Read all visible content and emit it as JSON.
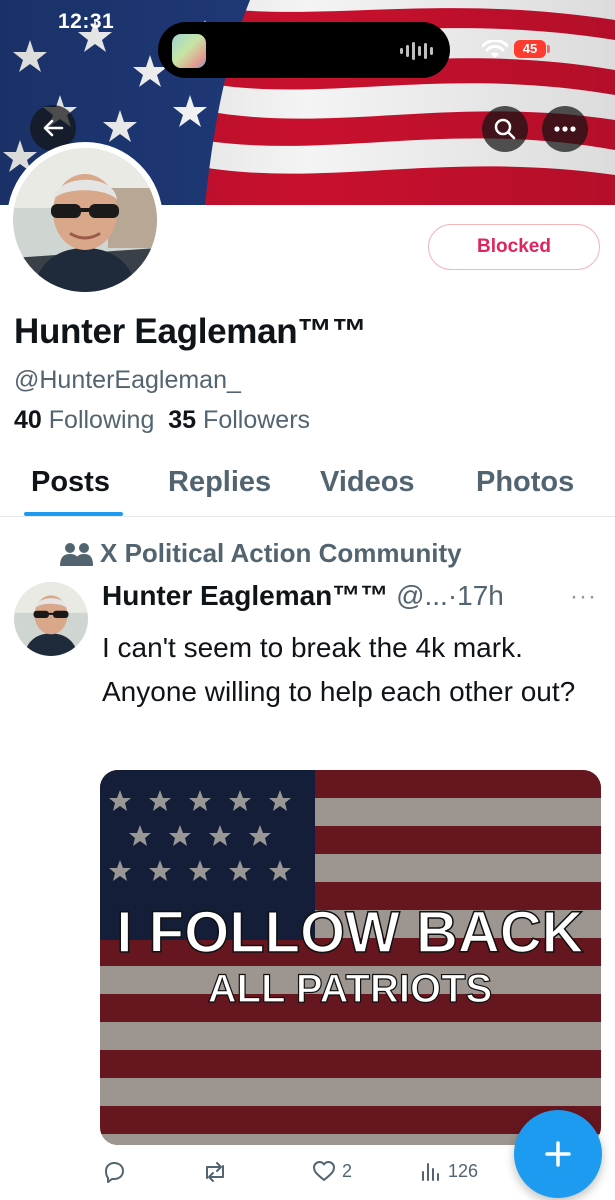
{
  "status_bar": {
    "time": "12:31",
    "battery": "45"
  },
  "profile": {
    "display_name": "Hunter Eagleman™™",
    "handle": "@HunterEagleman_",
    "following_count": "40",
    "following_label": "Following",
    "followers_count": "35",
    "followers_label": "Followers",
    "blocked_label": "Blocked"
  },
  "tabs": [
    {
      "label": "Posts",
      "active": true
    },
    {
      "label": "Replies",
      "active": false
    },
    {
      "label": "Videos",
      "active": false
    },
    {
      "label": "Photos",
      "active": false
    }
  ],
  "post": {
    "community": "X Political Action Community",
    "author_name": "Hunter Eagleman™™",
    "author_handle": "@...",
    "time": "·17h",
    "more": "···",
    "text": "I can't seem to break the 4k mark. Anyone willing to help each other out?",
    "image_line1": "I FOLLOW BACK",
    "image_line2": "ALL PATRIOTS",
    "likes": "2",
    "views": "126"
  },
  "icons": {
    "back": "arrow-left-icon",
    "search": "search-icon",
    "more": "more-icon",
    "community": "people-icon",
    "reply": "reply-icon",
    "repost": "repost-icon",
    "like": "heart-icon",
    "views": "analytics-icon",
    "fab": "plus-icon"
  },
  "colors": {
    "accent": "#1d9bf0",
    "blocked": "#e0245e"
  }
}
